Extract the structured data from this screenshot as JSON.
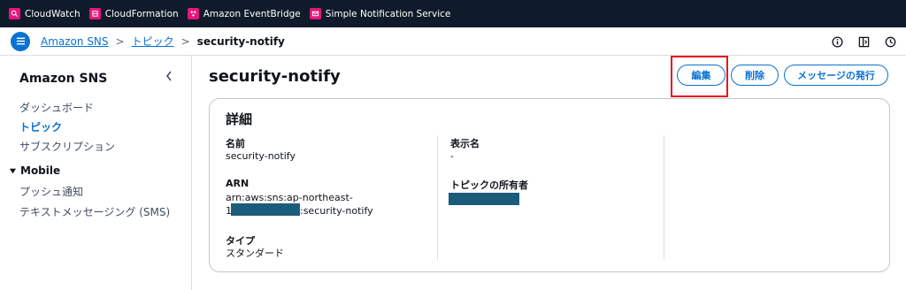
{
  "services": [
    {
      "label": "CloudWatch",
      "icon": "cloudwatch-icon"
    },
    {
      "label": "CloudFormation",
      "icon": "cloudformation-icon"
    },
    {
      "label": "Amazon EventBridge",
      "icon": "eventbridge-icon"
    },
    {
      "label": "Simple Notification Service",
      "icon": "sns-icon"
    }
  ],
  "breadcrumb": {
    "items": [
      "Amazon SNS",
      "トピック"
    ],
    "current": "security-notify",
    "separator": ">"
  },
  "sidebar": {
    "title": "Amazon SNS",
    "items": [
      "ダッシュボード",
      "トピック",
      "サブスクリプション"
    ],
    "active": "トピック",
    "group": {
      "label": "Mobile",
      "items": [
        "プッシュ通知",
        "テキストメッセージング (SMS)"
      ]
    }
  },
  "page": {
    "title": "security-notify",
    "buttons": {
      "edit": "編集",
      "delete": "削除",
      "publish": "メッセージの発行"
    }
  },
  "details": {
    "title": "詳細",
    "name_label": "名前",
    "name_value": "security-notify",
    "arn_label": "ARN",
    "arn_line1": "arn:aws:sns:ap-northeast-",
    "arn_line2_prefix": "1",
    "arn_line2_suffix": ":security-notify",
    "type_label": "タイプ",
    "type_value": "スタンダード",
    "display_name_label": "表示名",
    "display_name_value": "-",
    "owner_label": "トピックの所有者"
  },
  "colors": {
    "accent": "#0972d3",
    "topbar": "#0f1b2a",
    "highlight": "#e8141c",
    "redaction": "#1c5c7b",
    "service_icon": "#e7157b"
  }
}
